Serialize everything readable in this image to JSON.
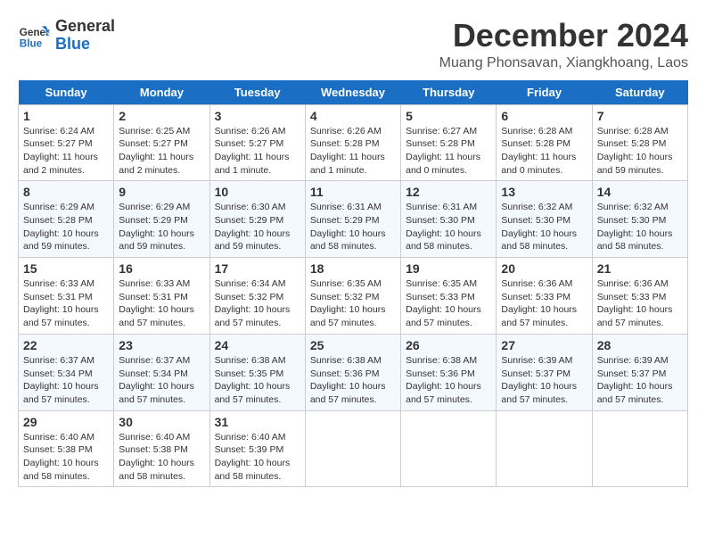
{
  "logo": {
    "line1": "General",
    "line2": "Blue"
  },
  "title": "December 2024",
  "location": "Muang Phonsavan, Xiangkhoang, Laos",
  "headers": [
    "Sunday",
    "Monday",
    "Tuesday",
    "Wednesday",
    "Thursday",
    "Friday",
    "Saturday"
  ],
  "weeks": [
    [
      {
        "day": "1",
        "sunrise": "6:24 AM",
        "sunset": "5:27 PM",
        "daylight": "11 hours and 2 minutes."
      },
      {
        "day": "2",
        "sunrise": "6:25 AM",
        "sunset": "5:27 PM",
        "daylight": "11 hours and 2 minutes."
      },
      {
        "day": "3",
        "sunrise": "6:26 AM",
        "sunset": "5:27 PM",
        "daylight": "11 hours and 1 minute."
      },
      {
        "day": "4",
        "sunrise": "6:26 AM",
        "sunset": "5:28 PM",
        "daylight": "11 hours and 1 minute."
      },
      {
        "day": "5",
        "sunrise": "6:27 AM",
        "sunset": "5:28 PM",
        "daylight": "11 hours and 0 minutes."
      },
      {
        "day": "6",
        "sunrise": "6:28 AM",
        "sunset": "5:28 PM",
        "daylight": "11 hours and 0 minutes."
      },
      {
        "day": "7",
        "sunrise": "6:28 AM",
        "sunset": "5:28 PM",
        "daylight": "10 hours and 59 minutes."
      }
    ],
    [
      {
        "day": "8",
        "sunrise": "6:29 AM",
        "sunset": "5:28 PM",
        "daylight": "10 hours and 59 minutes."
      },
      {
        "day": "9",
        "sunrise": "6:29 AM",
        "sunset": "5:29 PM",
        "daylight": "10 hours and 59 minutes."
      },
      {
        "day": "10",
        "sunrise": "6:30 AM",
        "sunset": "5:29 PM",
        "daylight": "10 hours and 59 minutes."
      },
      {
        "day": "11",
        "sunrise": "6:31 AM",
        "sunset": "5:29 PM",
        "daylight": "10 hours and 58 minutes."
      },
      {
        "day": "12",
        "sunrise": "6:31 AM",
        "sunset": "5:30 PM",
        "daylight": "10 hours and 58 minutes."
      },
      {
        "day": "13",
        "sunrise": "6:32 AM",
        "sunset": "5:30 PM",
        "daylight": "10 hours and 58 minutes."
      },
      {
        "day": "14",
        "sunrise": "6:32 AM",
        "sunset": "5:30 PM",
        "daylight": "10 hours and 58 minutes."
      }
    ],
    [
      {
        "day": "15",
        "sunrise": "6:33 AM",
        "sunset": "5:31 PM",
        "daylight": "10 hours and 57 minutes."
      },
      {
        "day": "16",
        "sunrise": "6:33 AM",
        "sunset": "5:31 PM",
        "daylight": "10 hours and 57 minutes."
      },
      {
        "day": "17",
        "sunrise": "6:34 AM",
        "sunset": "5:32 PM",
        "daylight": "10 hours and 57 minutes."
      },
      {
        "day": "18",
        "sunrise": "6:35 AM",
        "sunset": "5:32 PM",
        "daylight": "10 hours and 57 minutes."
      },
      {
        "day": "19",
        "sunrise": "6:35 AM",
        "sunset": "5:33 PM",
        "daylight": "10 hours and 57 minutes."
      },
      {
        "day": "20",
        "sunrise": "6:36 AM",
        "sunset": "5:33 PM",
        "daylight": "10 hours and 57 minutes."
      },
      {
        "day": "21",
        "sunrise": "6:36 AM",
        "sunset": "5:33 PM",
        "daylight": "10 hours and 57 minutes."
      }
    ],
    [
      {
        "day": "22",
        "sunrise": "6:37 AM",
        "sunset": "5:34 PM",
        "daylight": "10 hours and 57 minutes."
      },
      {
        "day": "23",
        "sunrise": "6:37 AM",
        "sunset": "5:34 PM",
        "daylight": "10 hours and 57 minutes."
      },
      {
        "day": "24",
        "sunrise": "6:38 AM",
        "sunset": "5:35 PM",
        "daylight": "10 hours and 57 minutes."
      },
      {
        "day": "25",
        "sunrise": "6:38 AM",
        "sunset": "5:36 PM",
        "daylight": "10 hours and 57 minutes."
      },
      {
        "day": "26",
        "sunrise": "6:38 AM",
        "sunset": "5:36 PM",
        "daylight": "10 hours and 57 minutes."
      },
      {
        "day": "27",
        "sunrise": "6:39 AM",
        "sunset": "5:37 PM",
        "daylight": "10 hours and 57 minutes."
      },
      {
        "day": "28",
        "sunrise": "6:39 AM",
        "sunset": "5:37 PM",
        "daylight": "10 hours and 57 minutes."
      }
    ],
    [
      {
        "day": "29",
        "sunrise": "6:40 AM",
        "sunset": "5:38 PM",
        "daylight": "10 hours and 58 minutes."
      },
      {
        "day": "30",
        "sunrise": "6:40 AM",
        "sunset": "5:38 PM",
        "daylight": "10 hours and 58 minutes."
      },
      {
        "day": "31",
        "sunrise": "6:40 AM",
        "sunset": "5:39 PM",
        "daylight": "10 hours and 58 minutes."
      },
      null,
      null,
      null,
      null
    ]
  ],
  "labels": {
    "sunrise": "Sunrise:",
    "sunset": "Sunset:",
    "daylight": "Daylight:"
  }
}
